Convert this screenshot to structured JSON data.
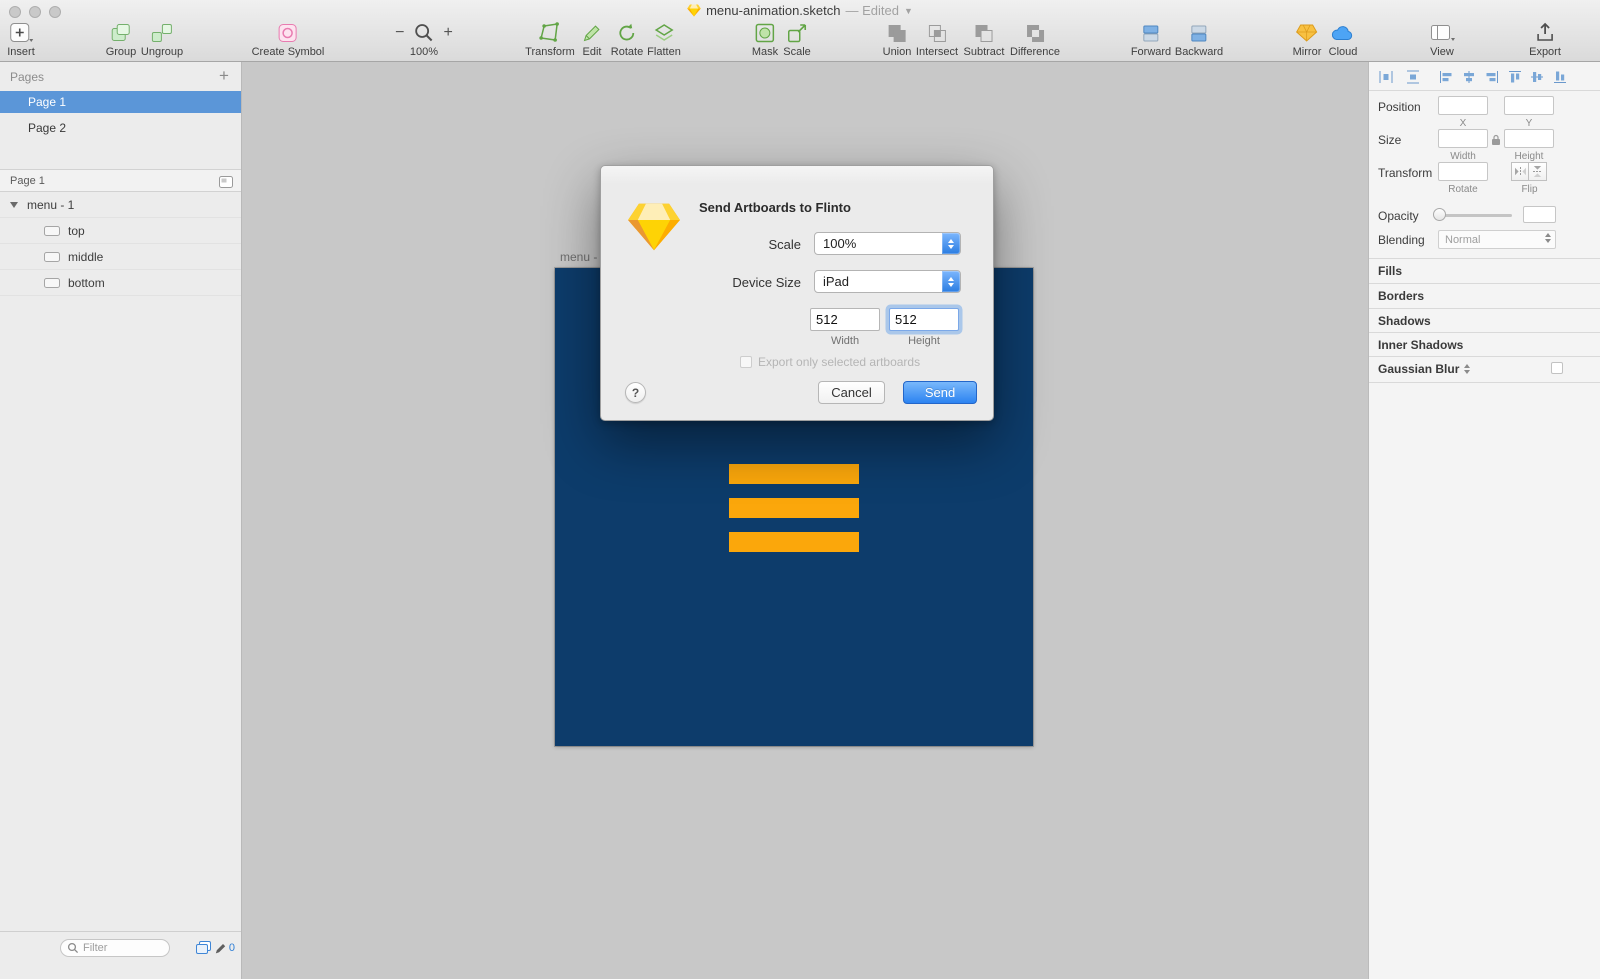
{
  "colors": {
    "accent_blue": "#2c83f1",
    "selection_blue": "#5b96d8",
    "artboard_navy": "#0d3c6b",
    "menu_bar_orange": "#fba70b"
  },
  "window": {
    "title": "menu-animation.sketch",
    "edited_suffix": "— Edited"
  },
  "toolbar": {
    "insert": "Insert",
    "group": "Group",
    "ungroup": "Ungroup",
    "create_symbol": "Create Symbol",
    "zoom_level": "100%",
    "transform": "Transform",
    "edit": "Edit",
    "rotate": "Rotate",
    "flatten": "Flatten",
    "mask": "Mask",
    "scale": "Scale",
    "union": "Union",
    "intersect": "Intersect",
    "subtract": "Subtract",
    "difference": "Difference",
    "forward": "Forward",
    "backward": "Backward",
    "mirror": "Mirror",
    "cloud": "Cloud",
    "view": "View",
    "export": "Export"
  },
  "pages_panel": {
    "header": "Pages",
    "add_label": "+",
    "pages": [
      {
        "label": "Page 1"
      },
      {
        "label": "Page 2"
      }
    ]
  },
  "layers_panel": {
    "header": "Page 1",
    "artboard": "menu - 1",
    "layers": [
      {
        "label": "top"
      },
      {
        "label": "middle"
      },
      {
        "label": "bottom"
      }
    ],
    "filter_placeholder": "Filter",
    "badge_count": "0"
  },
  "canvas": {
    "artboard_label": "menu - 1"
  },
  "dialog": {
    "title": "Send Artboards to Flinto",
    "scale_label": "Scale",
    "scale_value": "100%",
    "device_size_label": "Device Size",
    "device_size_value": "iPad",
    "width_value": "512",
    "width_label": "Width",
    "height_value": "512",
    "height_label": "Height",
    "checkbox_label": "Export only selected artboards",
    "help_label": "?",
    "cancel_label": "Cancel",
    "send_label": "Send"
  },
  "inspector": {
    "position_label": "Position",
    "x_label": "X",
    "y_label": "Y",
    "x_value": "",
    "y_value": "",
    "size_label": "Size",
    "width_label": "Width",
    "height_label": "Height",
    "width_value": "",
    "height_value": "",
    "transform_label": "Transform",
    "rotate_label": "Rotate",
    "rotate_value": "",
    "flip_label": "Flip",
    "opacity_label": "Opacity",
    "opacity_value": "",
    "blending_label": "Blending",
    "blending_value": "Normal",
    "sections": [
      "Fills",
      "Borders",
      "Shadows",
      "Inner Shadows"
    ],
    "gaussian_blur_label": "Gaussian Blur"
  }
}
